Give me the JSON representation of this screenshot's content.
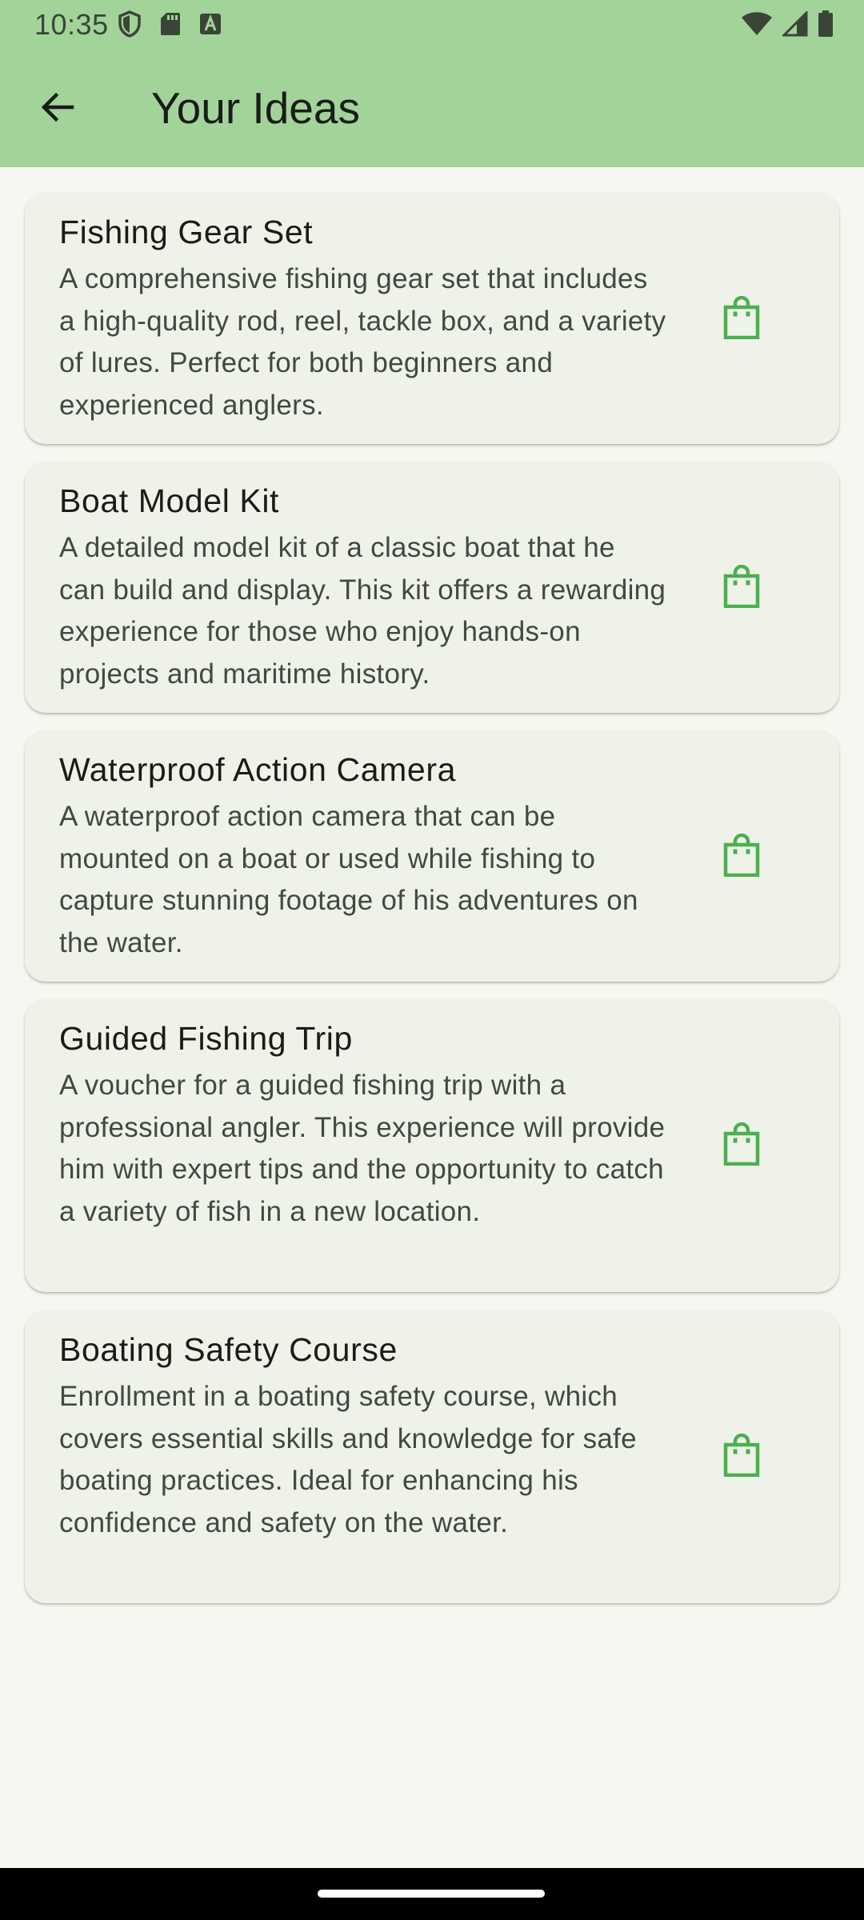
{
  "status_bar": {
    "time": "10:35",
    "icons_left": [
      "shield-icon",
      "sd-card-icon",
      "font-icon"
    ],
    "icons_right": [
      "wifi-icon",
      "cellular-signal-icon",
      "battery-icon"
    ]
  },
  "app_bar": {
    "title": "Your Ideas",
    "back_icon": "arrow-back-icon",
    "background_color": "#a2d49a"
  },
  "ideas": [
    {
      "title": "Fishing Gear Set",
      "description": "A comprehensive fishing gear set that includes a high-quality rod, reel, tackle box, and a variety of lures. Perfect for both beginners and experienced anglers.",
      "action_icon": "shopping-bag-icon"
    },
    {
      "title": "Boat Model Kit",
      "description": "A detailed model kit of a classic boat that he can build and display. This kit offers a rewarding experience for those who enjoy hands-on projects and maritime history.",
      "action_icon": "shopping-bag-icon"
    },
    {
      "title": "Waterproof Action Camera",
      "description": "A waterproof action camera that can be mounted on a boat or used while fishing to capture stunning footage of his adventures on the water.",
      "action_icon": "shopping-bag-icon"
    },
    {
      "title": "Guided Fishing Trip",
      "description": "A voucher for a guided fishing trip with a professional angler. This experience will provide him with expert tips and the opportunity to catch a variety of fish in a new location.",
      "action_icon": "shopping-bag-icon"
    },
    {
      "title": "Boating Safety Course",
      "description": "Enrollment in a boating safety course, which covers essential skills and knowledge for safe boating practices. Ideal for enhancing his confidence and safety on the water.",
      "action_icon": "shopping-bag-icon"
    }
  ],
  "colors": {
    "accent": "#4caf50",
    "card_background": "#eff2e9",
    "page_background": "#f5f8f0"
  }
}
